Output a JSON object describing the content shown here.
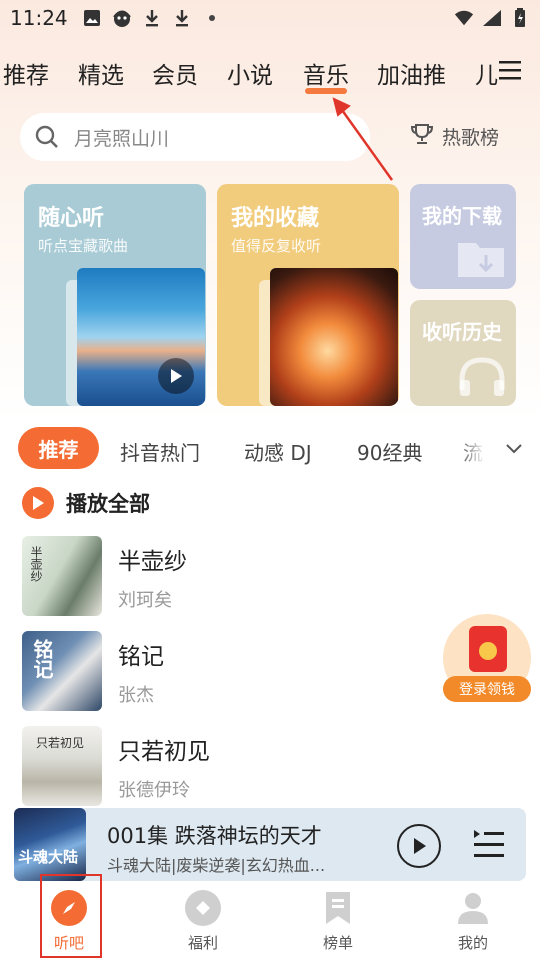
{
  "status_bar": {
    "time": "11:24"
  },
  "top_tabs": [
    {
      "label": "推荐"
    },
    {
      "label": "精选"
    },
    {
      "label": "会员"
    },
    {
      "label": "小说"
    },
    {
      "label": "音乐",
      "active": true
    },
    {
      "label": "加油推"
    },
    {
      "label": "儿"
    }
  ],
  "search": {
    "placeholder": "月亮照山川",
    "hot_label": "热歌榜"
  },
  "cards": {
    "random": {
      "title": "随心听",
      "subtitle": "听点宝藏歌曲"
    },
    "favorites": {
      "title": "我的收藏",
      "subtitle": "值得反复收听"
    },
    "downloads": {
      "title": "我的下载"
    },
    "history": {
      "title": "收听历史"
    }
  },
  "category_tabs": [
    {
      "label": "推荐",
      "active": true
    },
    {
      "label": "抖音热门"
    },
    {
      "label": "动感 DJ"
    },
    {
      "label": "90经典"
    },
    {
      "label": "流"
    }
  ],
  "play_all_label": "播放全部",
  "songs": [
    {
      "title": "半壶纱",
      "artist": "刘珂矣",
      "cover_text": "半壶纱"
    },
    {
      "title": "铭记",
      "artist": "张杰",
      "cover_text": "铭记"
    },
    {
      "title": "只若初见",
      "artist": "张德伊玲",
      "cover_text": "只若初见"
    }
  ],
  "promo": {
    "label": "登录领钱"
  },
  "mini_player": {
    "title": "001集 跌落神坛的天才",
    "subtitle": "斗魂大陆|废柴逆袭|玄幻热血...",
    "cover_text": "斗魂大陆"
  },
  "bottom_nav": [
    {
      "label": "听吧",
      "active": true,
      "icon": "compass-icon"
    },
    {
      "label": "福利",
      "icon": "gift-icon"
    },
    {
      "label": "榜单",
      "icon": "bookmark-icon"
    },
    {
      "label": "我的",
      "icon": "person-icon"
    }
  ],
  "colors": {
    "accent": "#f46b33",
    "annotation": "#e0352b"
  }
}
